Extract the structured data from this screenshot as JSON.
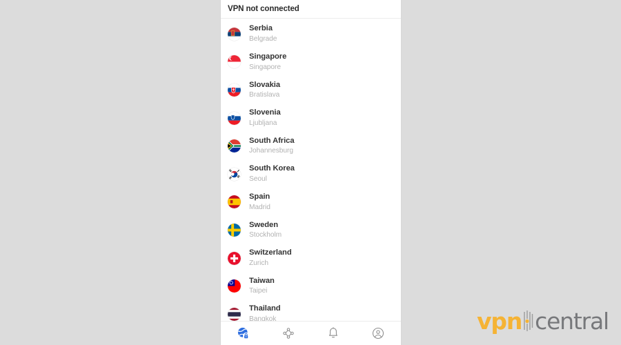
{
  "window": {
    "background_color": "#dcdcdc",
    "panel_background": "#ffffff"
  },
  "header": {
    "status_text": "VPN not connected"
  },
  "server_list": {
    "rows": [
      {
        "country": "Serbia",
        "city": "Belgrade",
        "flag": "flag-serbia"
      },
      {
        "country": "Singapore",
        "city": "Singapore",
        "flag": "flag-singapore"
      },
      {
        "country": "Slovakia",
        "city": "Bratislava",
        "flag": "flag-slovakia"
      },
      {
        "country": "Slovenia",
        "city": "Ljubljana",
        "flag": "flag-slovenia"
      },
      {
        "country": "South Africa",
        "city": "Johannesburg",
        "flag": "flag-south-africa"
      },
      {
        "country": "South Korea",
        "city": "Seoul",
        "flag": "flag-south-korea"
      },
      {
        "country": "Spain",
        "city": "Madrid",
        "flag": "flag-spain"
      },
      {
        "country": "Sweden",
        "city": "Stockholm",
        "flag": "flag-sweden"
      },
      {
        "country": "Switzerland",
        "city": "Zurich",
        "flag": "flag-switzerland"
      },
      {
        "country": "Taiwan",
        "city": "Taipei",
        "flag": "flag-taiwan"
      },
      {
        "country": "Thailand",
        "city": "Bangkok",
        "flag": "flag-thailand"
      }
    ]
  },
  "bottom_nav": {
    "items": [
      {
        "icon": "globe-lock-icon",
        "active": true
      },
      {
        "icon": "mesh-network-icon",
        "active": false
      },
      {
        "icon": "bell-icon",
        "active": false
      },
      {
        "icon": "account-circle-icon",
        "active": false
      }
    ],
    "active_color": "#2f6fe0",
    "inactive_color": "#8d8d8d"
  },
  "watermark": {
    "brand_first": "vpn",
    "brand_second": "central",
    "first_color": "#f5b335",
    "second_color": "#77787b"
  }
}
